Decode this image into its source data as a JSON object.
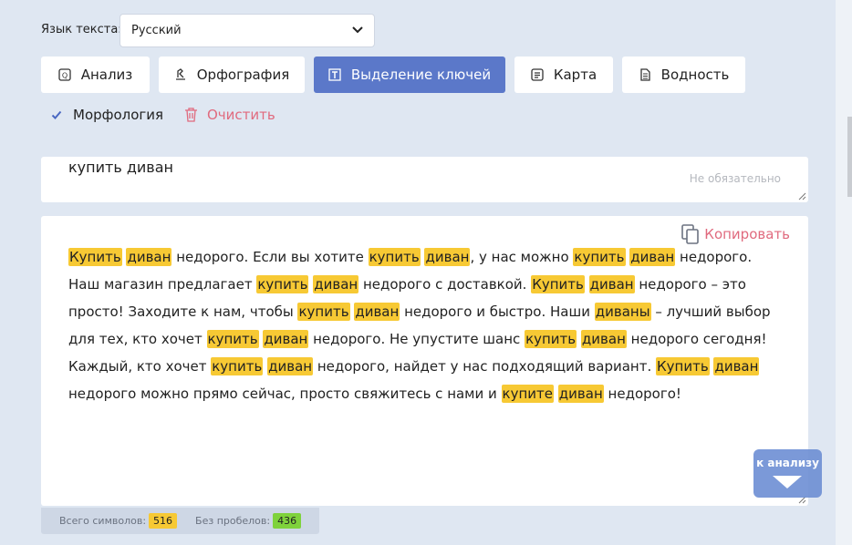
{
  "language": {
    "label": "Язык текста:",
    "selected": "Русский"
  },
  "tabs": [
    {
      "label": "Анализ",
      "icon": "analysis-icon"
    },
    {
      "label": "Орфография",
      "icon": "spelling-icon"
    },
    {
      "label": "Выделение ключей",
      "icon": "text-tool-icon",
      "active": true
    },
    {
      "label": "Карта",
      "icon": "map-icon"
    },
    {
      "label": "Водность",
      "icon": "document-icon"
    }
  ],
  "options": {
    "morphology_label": "Морфология",
    "morphology_checked": true,
    "clear_label": "Очистить"
  },
  "keywords": {
    "value": "купить диван",
    "placeholder": "Не обязательно"
  },
  "editor": {
    "copy_label": "Копировать",
    "segments": [
      {
        "t": "Купить",
        "h": true
      },
      {
        "t": " "
      },
      {
        "t": "диван",
        "h": true
      },
      {
        "t": " недорого. Если вы хотите "
      },
      {
        "t": "купить",
        "h": true
      },
      {
        "t": " "
      },
      {
        "t": "диван",
        "h": true
      },
      {
        "t": ", у нас можно "
      },
      {
        "t": "купить",
        "h": true
      },
      {
        "t": " "
      },
      {
        "t": "диван",
        "h": true
      },
      {
        "t": " недорого. Наш магазин предлагает "
      },
      {
        "t": "купить",
        "h": true
      },
      {
        "t": " "
      },
      {
        "t": "диван",
        "h": true
      },
      {
        "t": " недорого с доставкой. "
      },
      {
        "t": "Купить",
        "h": true
      },
      {
        "t": " "
      },
      {
        "t": "диван",
        "h": true
      },
      {
        "t": " недорого – это просто! Заходите к нам, чтобы "
      },
      {
        "t": "купить",
        "h": true
      },
      {
        "t": " "
      },
      {
        "t": "диван",
        "h": true
      },
      {
        "t": " недорого и быстро. Наши "
      },
      {
        "t": "диваны",
        "h": true
      },
      {
        "t": " – лучший выбор для тех, кто хочет "
      },
      {
        "t": "купить",
        "h": true
      },
      {
        "t": " "
      },
      {
        "t": "диван",
        "h": true
      },
      {
        "t": " недорого. Не упустите шанс "
      },
      {
        "t": "купить",
        "h": true
      },
      {
        "t": " "
      },
      {
        "t": "диван",
        "h": true
      },
      {
        "t": " недорого сегодня! Каждый, кто хочет "
      },
      {
        "t": "купить",
        "h": true
      },
      {
        "t": " "
      },
      {
        "t": "диван",
        "h": true
      },
      {
        "t": " недорого, найдет у нас подходящий вариант. "
      },
      {
        "t": "Купить",
        "h": true
      },
      {
        "t": " "
      },
      {
        "t": "диван",
        "h": true
      },
      {
        "t": " недорого можно прямо сейчас, просто свяжитесь с нами и "
      },
      {
        "t": "купите",
        "h": true
      },
      {
        "t": " "
      },
      {
        "t": "диван",
        "h": true
      },
      {
        "t": " недорого!"
      }
    ]
  },
  "stats": {
    "total_label": "Всего символов:",
    "total": "516",
    "nospace_label": "Без пробелов:",
    "nospace": "436"
  },
  "to_analysis": {
    "label": "к анализу"
  },
  "colors": {
    "accent": "#5b78c9",
    "highlight": "#f7c934",
    "danger": "#e06a7e",
    "green": "#7fd23c"
  }
}
